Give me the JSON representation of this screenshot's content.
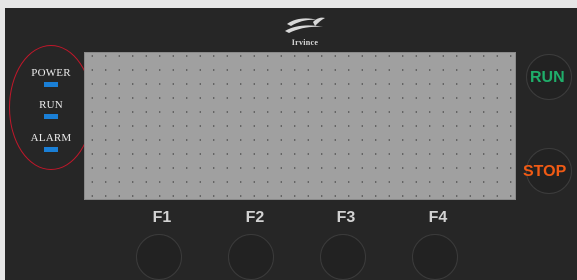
{
  "brand": {
    "logo_text": "Irvince",
    "logo_icon": "wave-logo-icon"
  },
  "indicators": [
    {
      "label": "POWER",
      "led_color": "#1a7fd6"
    },
    {
      "label": "RUN",
      "led_color": "#1a7fd6"
    },
    {
      "label": "ALARM",
      "led_color": "#1a7fd6"
    }
  ],
  "display": {
    "text": ""
  },
  "controls": {
    "run_label": "RUN",
    "run_color": "#1fae6a",
    "stop_label": "STOP",
    "stop_color": "#f05a14"
  },
  "function_keys": [
    {
      "label": "F1"
    },
    {
      "label": "F2"
    },
    {
      "label": "F3"
    },
    {
      "label": "F4"
    }
  ],
  "colors": {
    "panel": "#262626",
    "lcd": "#a0a0a0",
    "highlight_ring": "#c0172a"
  }
}
